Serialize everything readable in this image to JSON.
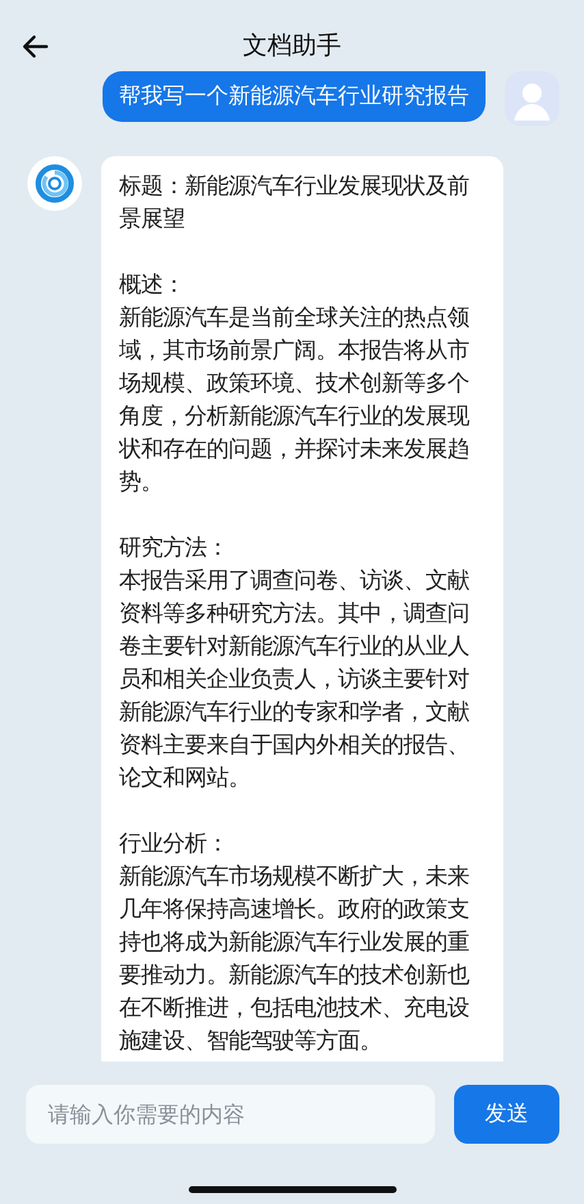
{
  "header": {
    "title": "文档助手"
  },
  "user_message": {
    "text": "帮我写一个新能源汽车行业研究报告"
  },
  "reply": {
    "title": "标题：新能源汽车行业发展现状及前景展望",
    "sections": [
      {
        "heading": "概述：",
        "body": "新能源汽车是当前全球关注的热点领域，其市场前景广阔。本报告将从市场规模、政策环境、技术创新等多个角度，分析新能源汽车行业的发展现状和存在的问题，并探讨未来发展趋势。"
      },
      {
        "heading": "研究方法：",
        "body": "本报告采用了调查问卷、访谈、文献资料等多种研究方法。其中，调查问卷主要针对新能源汽车行业的从业人员和相关企业负责人，访谈主要针对新能源汽车行业的专家和学者，文献资料主要来自于国内外相关的报告、论文和网站。"
      },
      {
        "heading": "行业分析：",
        "body": "新能源汽车市场规模不断扩大，未来几年将保持高速增长。政府的政策支持也将成为新能源汽车行业发展的重要推动力。新能源汽车的技术创新也在不断推进，包括电池技术、充电设施建设、智能驾驶等方面。"
      }
    ]
  },
  "input": {
    "placeholder": "请输入你需要的内容"
  },
  "send_button": {
    "label": "发送"
  }
}
